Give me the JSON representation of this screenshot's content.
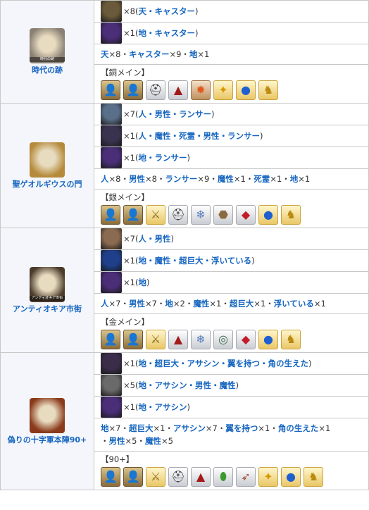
{
  "locations": [
    {
      "name": "時代の跡",
      "image_caption": "時代の跡",
      "enemies": [
        {
          "icon": "skeleton-portrait-icon",
          "count": "×8(",
          "traits": "天・キャスター",
          "close": ")"
        },
        {
          "icon": "shadow-portrait-icon",
          "count": "×1(",
          "traits": "地・キャスター",
          "close": ")"
        }
      ],
      "summary": [
        {
          "t": "天",
          "b": true
        },
        {
          "t": "×8・",
          "b": false
        },
        {
          "t": "キャスター",
          "b": true
        },
        {
          "t": "×9・",
          "b": false
        },
        {
          "t": "地",
          "b": true
        },
        {
          "t": "×1",
          "b": false
        }
      ],
      "materials_title": "【銅メイン】",
      "materials": [
        "servant-icon",
        "servant-icon",
        "helmet-icon",
        "red-cloak-icon",
        "fire-gem-icon",
        "gold-star-icon",
        "blue-orb-icon",
        "gold-statue-icon"
      ]
    },
    {
      "name": "聖ゲオルギウスの門",
      "image_caption": "",
      "enemies": [
        {
          "icon": "knight-portrait-icon",
          "count": "×7(",
          "traits": "人・男性・ランサー",
          "close": ")"
        },
        {
          "icon": "dark-knight-portrait-icon",
          "count": "×1(",
          "traits": "人・魔性・死霊・男性・ランサー",
          "close": ")"
        },
        {
          "icon": "shadow-portrait-icon",
          "count": "×1(",
          "traits": "地・ランサー",
          "close": ")"
        }
      ],
      "summary": [
        {
          "t": "人",
          "b": true
        },
        {
          "t": "×8・",
          "b": false
        },
        {
          "t": "男性",
          "b": true
        },
        {
          "t": "×8・",
          "b": false
        },
        {
          "t": "ランサー",
          "b": true
        },
        {
          "t": "×9・",
          "b": false
        },
        {
          "t": "魔性",
          "b": true
        },
        {
          "t": "×1・",
          "b": false
        },
        {
          "t": "死霊",
          "b": true
        },
        {
          "t": "×1・",
          "b": false
        },
        {
          "t": "地",
          "b": true
        },
        {
          "t": "×1",
          "b": false
        }
      ],
      "materials_title": "【銀メイン】",
      "materials": [
        "servant-icon",
        "servant-icon",
        "sword-icon",
        "helmet-icon",
        "crystal-icon",
        "pouch-icon",
        "red-gem-icon",
        "blue-orb-icon",
        "gold-statue-icon"
      ]
    },
    {
      "name": "アンティオキア市街",
      "image_caption": "アンティオキア市街",
      "enemies": [
        {
          "icon": "soldier-portrait-icon",
          "count": "×7(",
          "traits": "人・男性",
          "close": ")"
        },
        {
          "icon": "blue-monster-portrait-icon",
          "count": "×1(",
          "traits": "地・魔性・超巨大・浮いている",
          "close": ")"
        },
        {
          "icon": "shadow-portrait-icon",
          "count": "×1(",
          "traits": "地",
          "close": ")"
        }
      ],
      "summary": [
        {
          "t": "人",
          "b": true
        },
        {
          "t": "×7・",
          "b": false
        },
        {
          "t": "男性",
          "b": true
        },
        {
          "t": "×7・",
          "b": false
        },
        {
          "t": "地",
          "b": true
        },
        {
          "t": "×2・",
          "b": false
        },
        {
          "t": "魔性",
          "b": true
        },
        {
          "t": "×1・",
          "b": false
        },
        {
          "t": "超巨大",
          "b": true
        },
        {
          "t": "×1・",
          "b": false
        },
        {
          "t": "浮いている",
          "b": true
        },
        {
          "t": "×1",
          "b": false
        }
      ],
      "materials_title": "【金メイン】",
      "materials": [
        "servant-icon",
        "servant-icon",
        "sword-icon",
        "red-cloak-icon",
        "crystal-icon",
        "compass-icon",
        "red-gem-icon",
        "blue-orb-icon",
        "gold-statue-icon"
      ]
    },
    {
      "name": "偽りの十字軍本陣90+",
      "image_caption": "",
      "enemies": [
        {
          "icon": "dragon-portrait-icon",
          "count": "×1(",
          "traits": "地・超巨大・アサシン・翼を持つ・角の生えた",
          "close": ")"
        },
        {
          "icon": "assassin-portrait-icon",
          "count": "×5(",
          "traits": "地・アサシン・男性・魔性",
          "close": ")"
        },
        {
          "icon": "shadow-portrait-icon",
          "count": "×1(",
          "traits": "地・アサシン",
          "close": ")"
        }
      ],
      "summary": [
        {
          "t": "地",
          "b": true
        },
        {
          "t": "×7・",
          "b": false
        },
        {
          "t": "超巨大",
          "b": true
        },
        {
          "t": "×1・",
          "b": false
        },
        {
          "t": "アサシン",
          "b": true
        },
        {
          "t": "×7・",
          "b": false
        },
        {
          "t": "翼を持つ",
          "b": true
        },
        {
          "t": "×1・",
          "b": false
        },
        {
          "t": "角の生えた",
          "b": true
        },
        {
          "t": "×1\n・",
          "b": false
        },
        {
          "t": "男性",
          "b": true
        },
        {
          "t": "×5・",
          "b": false
        },
        {
          "t": "魔性",
          "b": true
        },
        {
          "t": "×5",
          "b": false
        }
      ],
      "materials_title": "【90+】",
      "materials": [
        "servant-icon",
        "servant-icon",
        "sword-icon",
        "helmet-icon",
        "red-cloak-icon",
        "green-seed-icon",
        "arrow-icon",
        "gold-star-icon",
        "blue-orb-icon",
        "gold-statue-icon"
      ]
    }
  ],
  "icon_styles": {
    "servant-icon": {
      "glyph": "👤",
      "cls": "portrait"
    },
    "helmet-icon": {
      "glyph": "⛑",
      "cls": "silver"
    },
    "red-cloak-icon": {
      "glyph": "▲",
      "cls": "silver",
      "color": "#a21a1a"
    },
    "fire-gem-icon": {
      "glyph": "✹",
      "cls": "bronze",
      "color": "#e0571a"
    },
    "gold-star-icon": {
      "glyph": "✦",
      "cls": "gold",
      "color": "#d49a00"
    },
    "blue-orb-icon": {
      "glyph": "●",
      "cls": "gold",
      "color": "#1f5fd0"
    },
    "gold-statue-icon": {
      "glyph": "♞",
      "cls": "gold",
      "color": "#b8860b"
    },
    "sword-icon": {
      "glyph": "⚔",
      "cls": "gold",
      "color": "#8a6a20"
    },
    "crystal-icon": {
      "glyph": "❄",
      "cls": "silver",
      "color": "#5b7fbf"
    },
    "pouch-icon": {
      "glyph": "⬣",
      "cls": "silver",
      "color": "#8a6a40"
    },
    "red-gem-icon": {
      "glyph": "◆",
      "cls": "silver",
      "color": "#c21b2a"
    },
    "compass-icon": {
      "glyph": "◎",
      "cls": "silver",
      "color": "#3d6b4a"
    },
    "green-seed-icon": {
      "glyph": "⬮",
      "cls": "silver",
      "color": "#3d9a2e"
    },
    "arrow-icon": {
      "glyph": "➶",
      "cls": "silver",
      "color": "#9a4a2a"
    }
  },
  "portrait_colors": {
    "skeleton-portrait-icon": "#6b5a3a",
    "shadow-portrait-icon": "#4a2e78",
    "knight-portrait-icon": "#5a6f8a",
    "dark-knight-portrait-icon": "#3a3350",
    "soldier-portrait-icon": "#8a6a50",
    "blue-monster-portrait-icon": "#1f3f8a",
    "dragon-portrait-icon": "#3a2d4a",
    "assassin-portrait-icon": "#6a6a6a"
  },
  "location_image_colors": [
    "#8a8074",
    "#b58a3a",
    "#4a3a2a",
    "#8a3a1a"
  ]
}
